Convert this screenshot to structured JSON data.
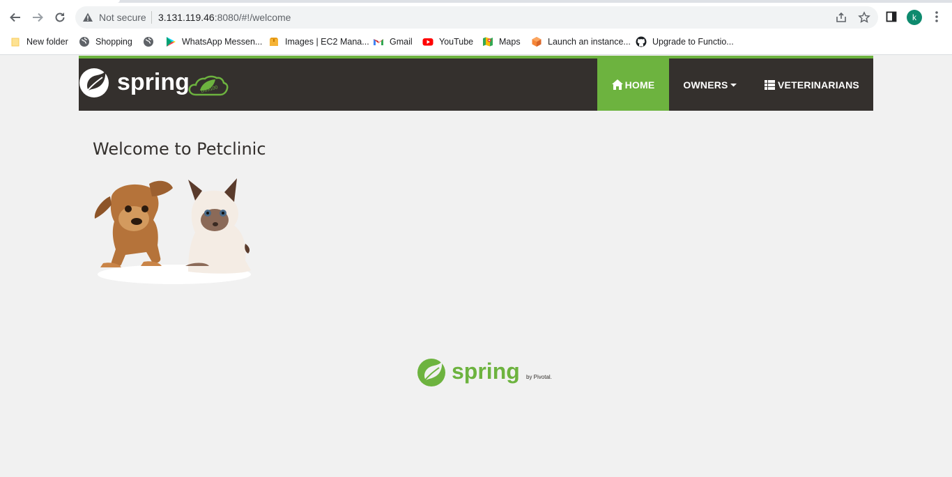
{
  "browser": {
    "security_label": "Not secure",
    "url_host": "3.131.119.46",
    "url_rest": ":8080/#!/welcome",
    "profile_initial": "k"
  },
  "bookmarks": [
    {
      "label": "New folder",
      "icon": "folder-icon"
    },
    {
      "label": "Shopping",
      "icon": "globe-icon"
    },
    {
      "label": "",
      "icon": "globe-icon"
    },
    {
      "label": "WhatsApp Messen...",
      "icon": "play-store-icon"
    },
    {
      "label": "Images | EC2 Mana...",
      "icon": "aws-box-icon"
    },
    {
      "label": "Gmail",
      "icon": "gmail-icon"
    },
    {
      "label": "YouTube",
      "icon": "youtube-icon"
    },
    {
      "label": "Maps",
      "icon": "maps-icon"
    },
    {
      "label": "Launch an instance...",
      "icon": "aws-cube-icon"
    },
    {
      "label": "Upgrade to Functio...",
      "icon": "github-icon"
    }
  ],
  "navbar": {
    "brand": "spring",
    "home": "HOME",
    "owners": "OWNERS",
    "veterinarians": "VETERINARIANS"
  },
  "main": {
    "title": "Welcome to Petclinic"
  },
  "footer": {
    "brand": "spring",
    "by": "by Pivotal."
  },
  "colors": {
    "accent": "#6db33f",
    "navbar": "#34302d",
    "background": "#f1f1f1"
  }
}
